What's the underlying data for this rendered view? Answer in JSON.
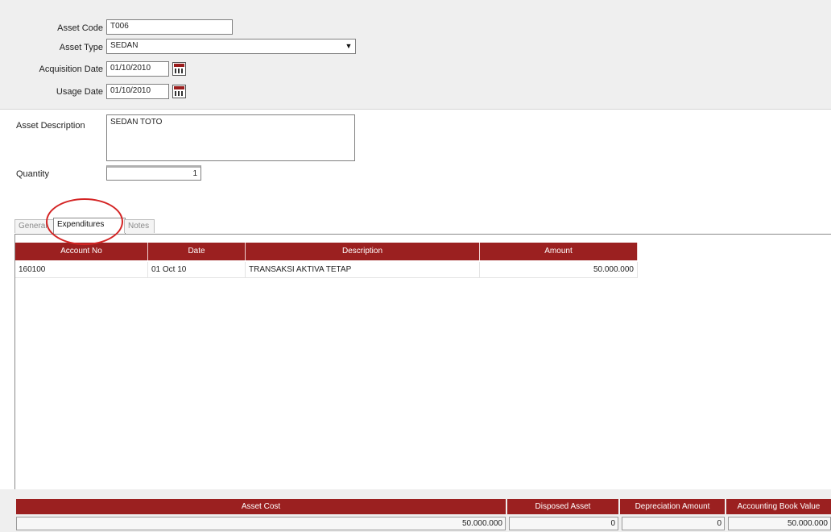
{
  "form": {
    "asset_code": {
      "label": "Asset Code",
      "value": "T006"
    },
    "asset_type": {
      "label": "Asset Type",
      "value": "SEDAN"
    },
    "acquisition_date": {
      "label": "Acquisition Date",
      "value": "01/10/2010"
    },
    "usage_date": {
      "label": "Usage Date",
      "value": "01/10/2010"
    },
    "asset_description": {
      "label": "Asset Description",
      "value": "SEDAN TOTO"
    },
    "quantity": {
      "label": "Quantity",
      "value": "1"
    }
  },
  "tabs": [
    {
      "label": "General",
      "active": false
    },
    {
      "label": "Expenditures",
      "active": true
    },
    {
      "label": "Notes",
      "active": false
    }
  ],
  "expenditures": {
    "columns": [
      "Account No",
      "Date",
      "Description",
      "Amount"
    ],
    "rows": [
      {
        "account_no": "160100",
        "date": "01 Oct 10",
        "description": "TRANSAKSI AKTIVA TETAP",
        "amount": "50.000.000"
      }
    ]
  },
  "summary": {
    "asset_cost": {
      "label": "Asset Cost",
      "value": "50.000.000"
    },
    "disposed_asset": {
      "label": "Disposed Asset",
      "value": "0"
    },
    "depreciation_amount": {
      "label": "Depreciation Amount",
      "value": "0"
    },
    "accounting_book_value": {
      "label": "Accounting Book Value",
      "value": "50.000.000"
    }
  },
  "colors": {
    "header_bg": "#9b2020",
    "annotation": "#d42424"
  },
  "icons": {
    "calendar": "calendar-icon",
    "dropdown": "chevron-down-icon"
  }
}
